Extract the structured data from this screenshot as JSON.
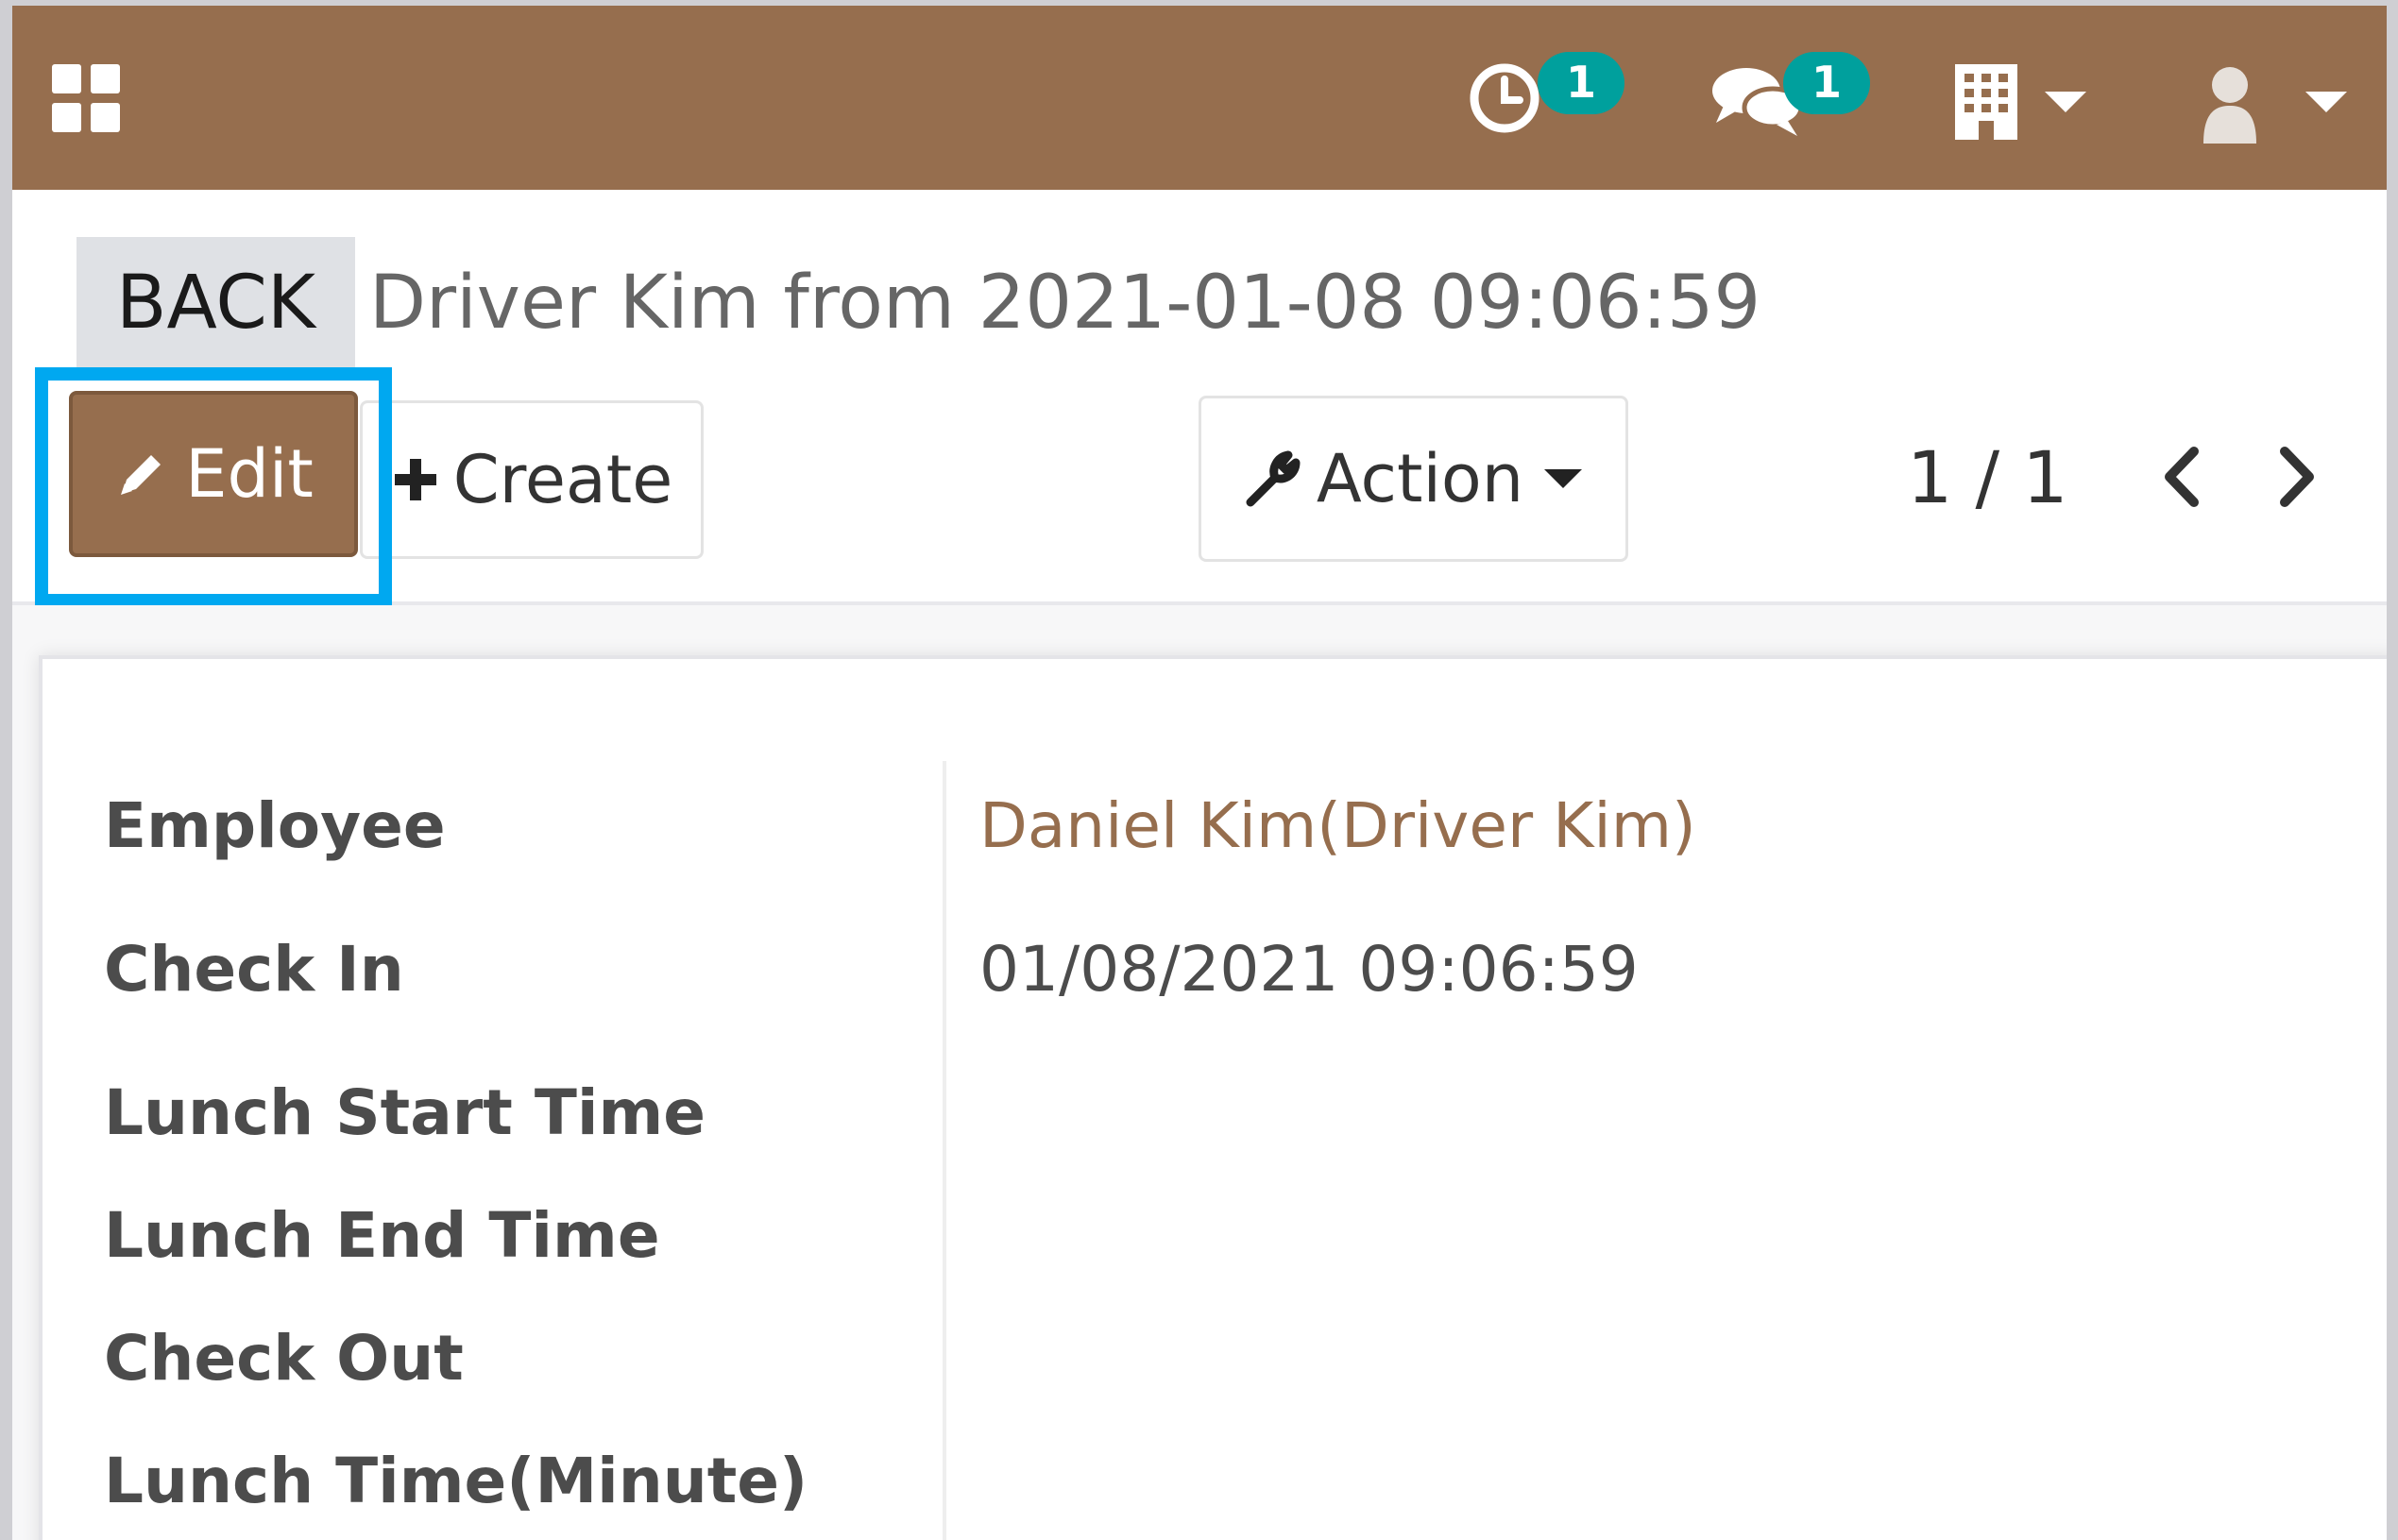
{
  "colors": {
    "brand": "#966e4e",
    "badge": "#00a09d",
    "highlight": "#00a8f0"
  },
  "navbar": {
    "apps_icon": "apps-grid-icon",
    "activity": {
      "icon": "clock-icon",
      "count": "1"
    },
    "messages": {
      "icon": "chat-bubbles-icon",
      "count": "1"
    },
    "company": {
      "icon": "building-icon"
    },
    "user": {
      "icon": "user-avatar-icon"
    }
  },
  "control_panel": {
    "back_label": "BACK",
    "title": "Driver Kim from 2021-01-08 09:06:59",
    "edit_label": "Edit",
    "create_label": "Create",
    "action_label": "Action",
    "pager": "1 / 1"
  },
  "form": {
    "fields": [
      {
        "label": "Employee",
        "value": "Daniel Kim(Driver Kim)"
      },
      {
        "label": "Check In",
        "value": "01/08/2021 09:06:59"
      },
      {
        "label": "Lunch Start Time",
        "value": ""
      },
      {
        "label": "Lunch End Time",
        "value": ""
      },
      {
        "label": "Check Out",
        "value": ""
      },
      {
        "label": "Lunch Time(Minute)",
        "value": ""
      }
    ]
  }
}
